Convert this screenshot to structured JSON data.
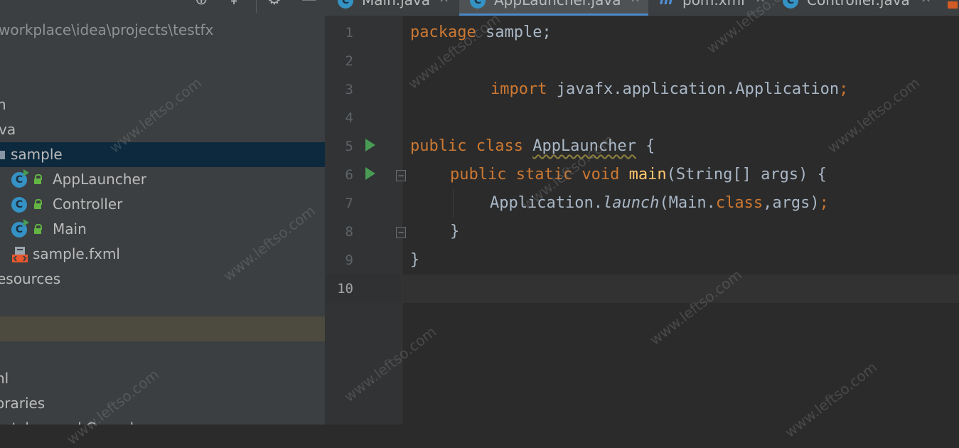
{
  "project_panel": {
    "path": "workplace\\idea\\projects\\testfx",
    "toolbar_icons": [
      "target-icon",
      "collapse-icon",
      "gear-icon",
      "minimize-icon"
    ],
    "tree": [
      {
        "label": "n"
      },
      {
        "label": "va"
      },
      {
        "label": "sample",
        "selected": true
      },
      {
        "label": "AppLauncher",
        "icon": "class-icon",
        "icon_letter": "C"
      },
      {
        "label": "Controller",
        "icon": "class-icon",
        "icon_letter": "C"
      },
      {
        "label": "Main",
        "icon": "class-icon",
        "icon_letter": "C"
      },
      {
        "label": "sample.fxml",
        "icon": "fxml-icon"
      },
      {
        "label": "esources"
      },
      {
        "label": "",
        "highlighted": true
      },
      {
        "label": "l"
      },
      {
        "label": "nl"
      },
      {
        "label": "oraries"
      },
      {
        "label": "ratches and Consoles"
      }
    ]
  },
  "editor": {
    "tabs": [
      {
        "label": "Main.java",
        "icon": "class-icon",
        "icon_letter": "C",
        "active": false
      },
      {
        "label": "AppLauncher.java",
        "icon": "class-icon",
        "icon_letter": "C",
        "active": true
      },
      {
        "label": "pom.xml",
        "icon": "maven-icon",
        "icon_letter": "m",
        "active": false
      },
      {
        "label": "Controller.java",
        "icon": "class-icon",
        "icon_letter": "C",
        "active": false
      }
    ],
    "close_glyph": "×",
    "line_numbers": [
      "1",
      "2",
      "3",
      "4",
      "5",
      "6",
      "7",
      "8",
      "9",
      "10"
    ],
    "current_line": "10",
    "code": {
      "l1_kw": "package",
      "l1_rest": " sample;",
      "l3_kw": "import",
      "l3_rest": " javafx.application.Application",
      "l3_semi": ";",
      "l5_kw": "public class",
      "l5_name": "AppLauncher",
      "l5_rest": " {",
      "l6_kw": "public static void",
      "l6_fn": "main",
      "l6_rest": "(String[] args) {",
      "l7_a": "Application.",
      "l7_b": "launch",
      "l7_c": "(Main.",
      "l7_d": "class",
      "l7_e": ",args)",
      "l7_f": ";",
      "l8": "}",
      "l9": "}"
    }
  },
  "watermark": "www.leftso.com",
  "colors": {
    "keyword": "#cc7832",
    "method": "#ffc66d",
    "code_text": "#a9b7c6",
    "selection": "#0d293e",
    "run_marker": "#499c54",
    "class_icon": "#3592c4"
  }
}
